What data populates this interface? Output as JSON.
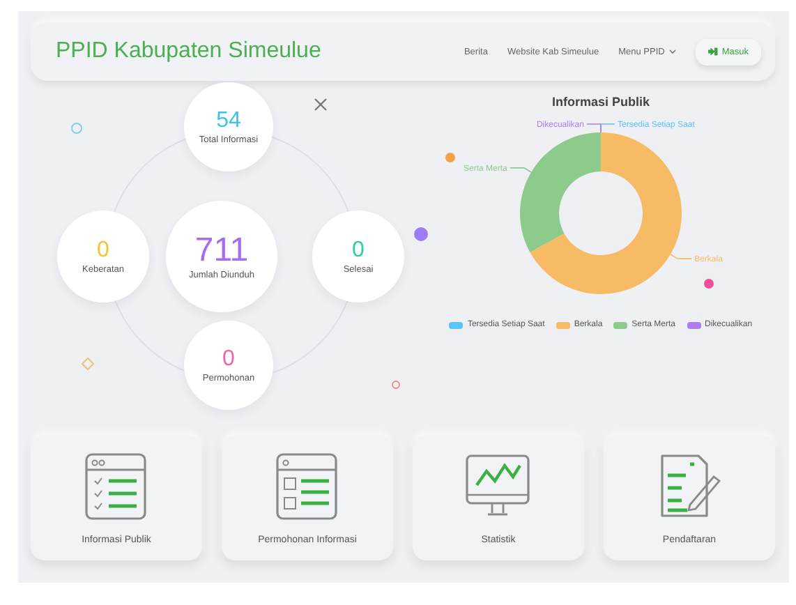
{
  "header": {
    "title": "PPID Kabupaten Simeulue",
    "nav": [
      {
        "label": "Berita",
        "kind": "link"
      },
      {
        "label": "Website Kab Simeulue",
        "kind": "link"
      },
      {
        "label": "Menu PPID",
        "kind": "dropdown"
      }
    ],
    "login_button": "Masuk"
  },
  "stats": [
    {
      "value": "54",
      "label": "Total Informasi",
      "color": "#3ec2ea",
      "kind": "top"
    },
    {
      "value": "0",
      "label": "Keberatan",
      "color": "#f4c531",
      "kind": "left"
    },
    {
      "value": "711",
      "label": "Jumlah Diunduh",
      "color": "#a66cf0",
      "kind": "center"
    },
    {
      "value": "0",
      "label": "Selesai",
      "color": "#2fcf9c",
      "kind": "right"
    },
    {
      "value": "0",
      "label": "Permohonan",
      "color": "#f266a8",
      "kind": "bottom"
    }
  ],
  "chart": {
    "chart_data": {
      "type": "donut",
      "title": "Informasi Publik",
      "categories": [
        "Tersedia Setiap Saat",
        "Berkala",
        "Serta Merta",
        "Dikecualikan"
      ],
      "values": [
        0,
        67,
        33,
        0
      ]
    },
    "legend": [
      {
        "label": "Tersedia Setiap Saat",
        "color": "#5cc3f5"
      },
      {
        "label": "Berkala",
        "color": "#f7bb66"
      },
      {
        "label": "Serta Merta",
        "color": "#8ccb8c"
      },
      {
        "label": "Dikecualikan",
        "color": "#ad7cf0"
      }
    ]
  },
  "cards": [
    {
      "label": "Informasi Publik",
      "kind": "checklist"
    },
    {
      "label": "Permohonan Informasi",
      "kind": "form"
    },
    {
      "label": "Statistik",
      "kind": "monitor"
    },
    {
      "label": "Pendaftaran",
      "kind": "document"
    }
  ]
}
